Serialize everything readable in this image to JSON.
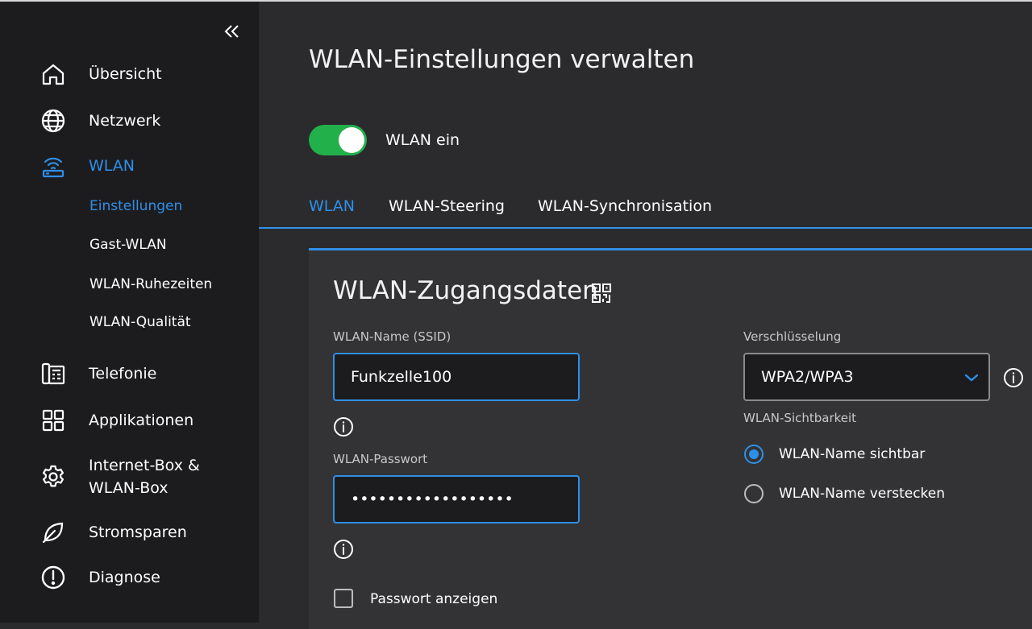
{
  "sidebar": {
    "items": [
      {
        "label": "Übersicht",
        "icon": "home-icon"
      },
      {
        "label": "Netzwerk",
        "icon": "globe-icon"
      },
      {
        "label": "WLAN",
        "icon": "router-icon",
        "active": true
      },
      {
        "label": "Telefonie",
        "icon": "phone-icon"
      },
      {
        "label": "Applikationen",
        "icon": "apps-icon"
      },
      {
        "label": "Internet-Box &\nWLAN-Box",
        "line1": "Internet-Box &",
        "line2": "WLAN-Box",
        "icon": "gear-icon"
      },
      {
        "label": "Stromsparen",
        "icon": "leaf-icon"
      },
      {
        "label": "Diagnose",
        "icon": "alert-icon"
      }
    ],
    "sub_items": [
      "Einstellungen",
      "Gast-WLAN",
      "WLAN-Ruhezeiten",
      "WLAN-Qualität"
    ]
  },
  "main": {
    "title": "WLAN-Einstellungen verwalten",
    "toggle_label": "WLAN ein",
    "toggle_on": true,
    "tabs": [
      "WLAN",
      "WLAN-Steering",
      "WLAN-Synchronisation"
    ]
  },
  "card": {
    "title": "WLAN-Zugangsdaten",
    "ssid_label": "WLAN-Name (SSID)",
    "ssid_value": "Funkzelle100",
    "password_label": "WLAN-Passwort",
    "password_value": "••••••••••••••••••",
    "show_password_label": "Passwort anzeigen",
    "encryption_label": "Verschlüsselung",
    "encryption_value": "WPA2/WPA3",
    "visibility_label": "WLAN-Sichtbarkeit",
    "visible_option": "WLAN-Name sichtbar",
    "hidden_option": "WLAN-Name verstecken"
  },
  "colors": {
    "accent": "#2f8fe8",
    "toggle_on": "#22b04b",
    "sidebar_bg": "#1c1c1f",
    "main_bg": "#2b2b2e",
    "card_bg": "#333336"
  }
}
